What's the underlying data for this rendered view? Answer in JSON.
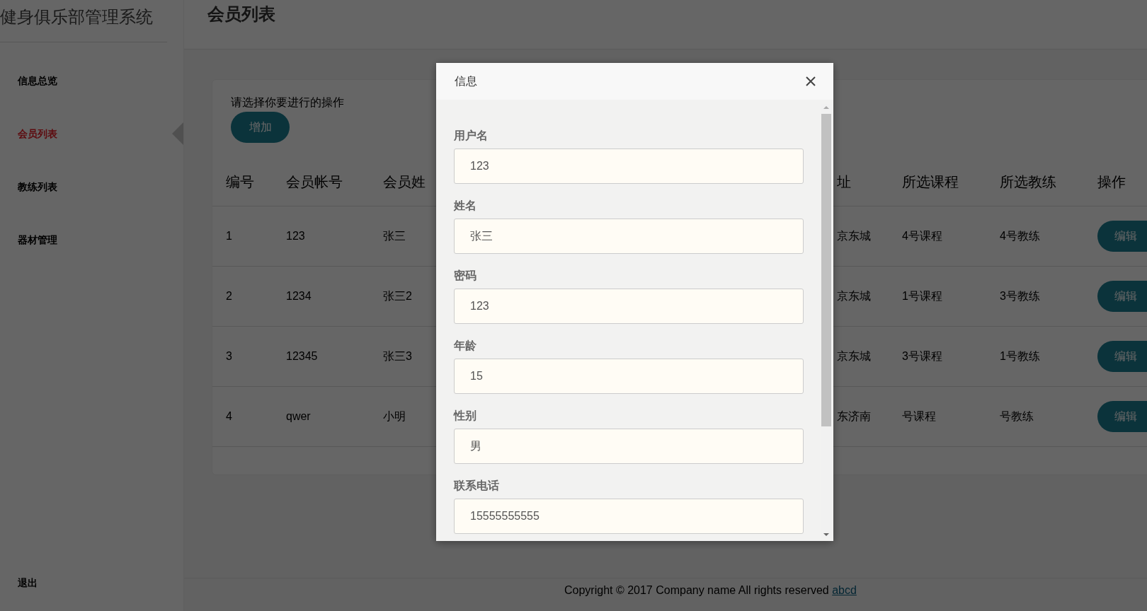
{
  "sidebar": {
    "title": "健身俱乐部管理系统",
    "items": [
      {
        "label": "信息总览",
        "selected": false
      },
      {
        "label": "会员列表",
        "selected": true
      },
      {
        "label": "教练列表",
        "selected": false
      },
      {
        "label": "器材管理",
        "selected": false
      }
    ],
    "logout": "退出"
  },
  "page": {
    "title": "会员列表",
    "hint": "请选择你要进行的操作",
    "add_button": "增加"
  },
  "table": {
    "columns": [
      "编号",
      "会员帐号",
      "会员姓",
      "址",
      "所选课程",
      "所选教练",
      "操作"
    ],
    "rows": [
      {
        "cells": [
          "1",
          "123",
          "张三",
          "京东城",
          "4号课程",
          "4号教练"
        ],
        "action": "编辑"
      },
      {
        "cells": [
          "2",
          "1234",
          "张三2",
          "京东城",
          "1号课程",
          "3号教练"
        ],
        "action": "编辑"
      },
      {
        "cells": [
          "3",
          "12345",
          "张三3",
          "京东城",
          "3号课程",
          "1号教练"
        ],
        "action": "编辑"
      },
      {
        "cells": [
          "4",
          "qwer",
          "小明",
          "东济南",
          "号课程",
          "号教练"
        ],
        "action": "编辑"
      }
    ]
  },
  "footer": {
    "text": "Copyright © 2017 Company name All rights reserved",
    "link": "abcd"
  },
  "dialog": {
    "title": "信息",
    "fields": [
      {
        "label": "用户名",
        "value": "123"
      },
      {
        "label": "姓名",
        "value": "张三"
      },
      {
        "label": "密码",
        "value": "123"
      },
      {
        "label": "年龄",
        "value": "15"
      },
      {
        "label": "性别",
        "value": "男"
      },
      {
        "label": "联系电话",
        "value": "15555555555"
      }
    ]
  }
}
